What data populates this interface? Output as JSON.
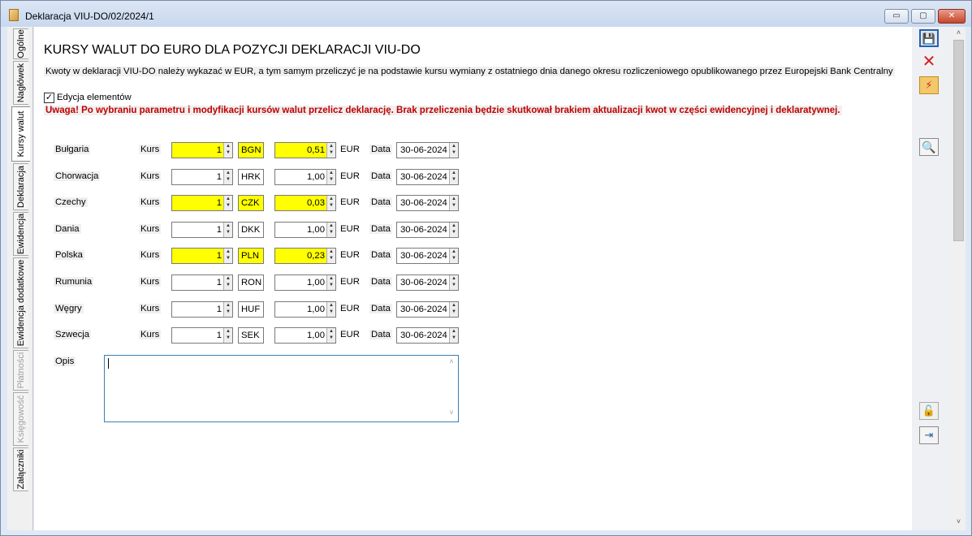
{
  "window": {
    "title": "Deklaracja VIU-DO/02/2024/1",
    "min_glyph": "▭",
    "max_glyph": "▢",
    "close_glyph": "✕"
  },
  "tabs": [
    {
      "label": "Ogólne",
      "state": "normal"
    },
    {
      "label": "Nagłówek",
      "state": "normal"
    },
    {
      "label": "Kursy walut",
      "state": "active"
    },
    {
      "label": "Deklaracja",
      "state": "normal"
    },
    {
      "label": "Ewidencja",
      "state": "normal"
    },
    {
      "label": "Ewidencja dodatkowe",
      "state": "normal"
    },
    {
      "label": "Płatności",
      "state": "disabled"
    },
    {
      "label": "Księgowość",
      "state": "disabled"
    },
    {
      "label": "Załączniki",
      "state": "normal"
    }
  ],
  "main": {
    "heading": "KURSY WALUT DO EURO DLA POZYCJI DEKLARACJI VIU-DO",
    "info": "Kwoty w deklaracji VIU-DO należy wykazać w EUR, a tym samym przeliczyć je na podstawie kursu wymiany z ostatniego dnia danego okresu rozliczeniowego opublikowanego przez Europejski Bank Centralny",
    "edit_checkbox": {
      "label": "Edycja elementów",
      "checked": true,
      "mark": "✓"
    },
    "warning": "Uwaga! Po wybraniu parametru i modyfikacji kursów walut przelicz deklarację. Brak przeliczenia będzie skutkował brakiem aktualizacji kwot w części ewidencyjnej i deklaratywnej."
  },
  "labels": {
    "kurs": "Kurs",
    "eur": "EUR",
    "data": "Data",
    "opis": "Opis"
  },
  "rates": [
    {
      "country": "Bułgaria",
      "qty": "1",
      "code": "BGN",
      "rate": "0,51",
      "date": "30-06-2024",
      "highlight": true
    },
    {
      "country": "Chorwacja",
      "qty": "1",
      "code": "HRK",
      "rate": "1,00",
      "date": "30-06-2024",
      "highlight": false
    },
    {
      "country": "Czechy",
      "qty": "1",
      "code": "CZK",
      "rate": "0,03",
      "date": "30-06-2024",
      "highlight": true
    },
    {
      "country": "Dania",
      "qty": "1",
      "code": "DKK",
      "rate": "1,00",
      "date": "30-06-2024",
      "highlight": false
    },
    {
      "country": "Polska",
      "qty": "1",
      "code": "PLN",
      "rate": "0,23",
      "date": "30-06-2024",
      "highlight": true
    },
    {
      "country": "Rumunia",
      "qty": "1",
      "code": "RON",
      "rate": "1,00",
      "date": "30-06-2024",
      "highlight": false
    },
    {
      "country": "Węgry",
      "qty": "1",
      "code": "HUF",
      "rate": "1,00",
      "date": "30-06-2024",
      "highlight": false
    },
    {
      "country": "Szwecja",
      "qty": "1",
      "code": "SEK",
      "rate": "1,00",
      "date": "30-06-2024",
      "highlight": false
    }
  ],
  "opis_value": "",
  "colors": {
    "highlight": "#ffff00",
    "warning": "#c00000",
    "focus_border": "#3c7fb1"
  },
  "icons": {
    "save": "save-icon",
    "cancel": "cancel-icon",
    "calculate": "calculate-icon",
    "search": "search-icon",
    "lock": "lock-icon",
    "pin": "pin-icon"
  },
  "glyphs": {
    "spin_up": "▲",
    "spin_down": "▼",
    "scroll_up": "˄",
    "scroll_down": "˅",
    "save": "💾",
    "cancel": "✕",
    "calculate": "⚡",
    "search": "🔍",
    "lock": "🔓",
    "pin": "⇥"
  }
}
